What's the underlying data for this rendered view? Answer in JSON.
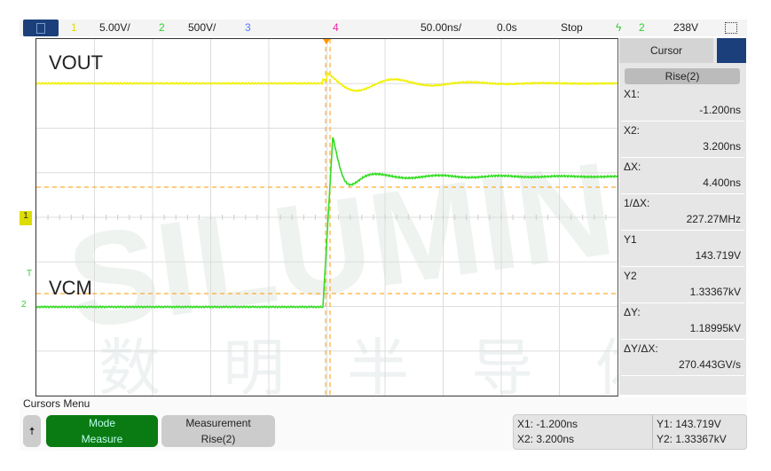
{
  "topbar": {
    "ch1_num": "1",
    "ch1_scale": "5.00V/",
    "ch2_num": "2",
    "ch2_scale": "500V/",
    "ch3_num": "3",
    "ch4_num": "4",
    "timebase": "50.00ns/",
    "delay": "0.0s",
    "run_state": "Stop",
    "trigger_source": "2",
    "trigger_level": "238V"
  },
  "labels": {
    "vout": "VOUT",
    "vcm": "VCM",
    "ch1_marker": "1",
    "ch2_marker": "2",
    "trigger_marker": "T"
  },
  "watermark": {
    "brand": "SILUMIN",
    "cn": "数明半导体"
  },
  "sidebar": {
    "title": "Cursor",
    "mode": "Rise(2)",
    "rows": [
      {
        "label": "X1:",
        "value": "-1.200ns"
      },
      {
        "label": "X2:",
        "value": "3.200ns"
      },
      {
        "label": "ΔX:",
        "value": "4.400ns"
      },
      {
        "label": "1/ΔX:",
        "value": "227.27MHz"
      },
      {
        "label": "Y1",
        "value": "143.719V"
      },
      {
        "label": "Y2",
        "value": "1.33367kV"
      },
      {
        "label": "ΔY:",
        "value": "1.18995kV"
      },
      {
        "label": "ΔY/ΔX:",
        "value": "270.443GV/s"
      }
    ]
  },
  "softkeys": {
    "menu_title": "Cursors Menu",
    "mode_label": "Mode",
    "mode_value": "Measure",
    "meas_label": "Measurement",
    "meas_value": "Rise(2)"
  },
  "readout": {
    "x1": "X1: -1.200ns",
    "x2": "X2: 3.200ns",
    "y1": "Y1: 143.719V",
    "y2": "Y2: 1.33367kV"
  },
  "colors": {
    "ch1": "#f0f000",
    "ch2": "#33dd22",
    "ch3": "#5577ff",
    "ch4": "#ee22aa",
    "cursor": "#ff9900",
    "menu_btn": "#1b3f7a",
    "mode_btn": "#0a7a12"
  }
}
